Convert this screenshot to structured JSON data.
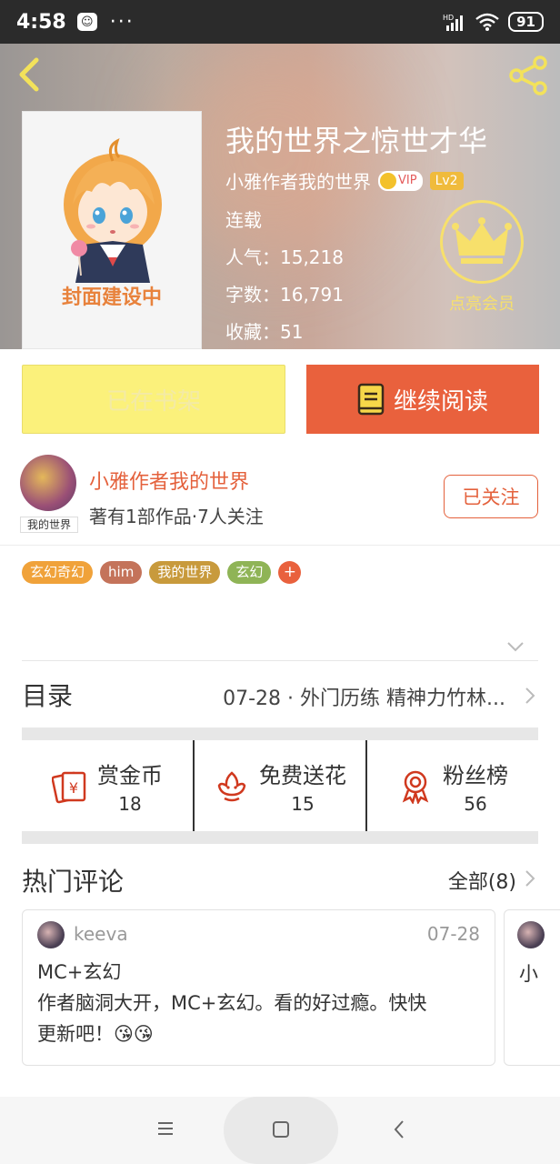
{
  "status_bar": {
    "time": "4:58",
    "dots": "···",
    "network": "HD",
    "battery": "91"
  },
  "book": {
    "title": "我的世界之惊世才华",
    "cover_text": "封面建设中",
    "author": "小雅作者我的世界",
    "vip_badge": "VIP",
    "level": "Lv2",
    "status": "连载",
    "popularity": "人气：15,218",
    "word_count": "字数：16,791",
    "favorites": "收藏：51",
    "vip_action": "点亮会员"
  },
  "actions": {
    "shelf_label": "已在书架",
    "read_label": "继续阅读"
  },
  "author_section": {
    "name": "小雅作者我的世界",
    "avatar_tag": "我的世界",
    "meta": "著有1部作品·7人关注",
    "follow_label": "已关注"
  },
  "tags": [
    {
      "label": "玄幻奇幻",
      "color": "#f0a23a"
    },
    {
      "label": "him",
      "color": "#c4735a"
    },
    {
      "label": "我的世界",
      "color": "#c89a3c"
    },
    {
      "label": "玄幻",
      "color": "#8fb456"
    },
    {
      "label": "+",
      "color": "#e9613d"
    }
  ],
  "toc": {
    "label": "目录",
    "latest_chapter": "07-28 · 外门历练 精神力竹林..."
  },
  "stats": [
    {
      "label": "赏金币",
      "value": "18",
      "icon": "reward-coin-icon"
    },
    {
      "label": "免费送花",
      "value": "15",
      "icon": "flower-icon"
    },
    {
      "label": "粉丝榜",
      "value": "56",
      "icon": "medal-icon"
    }
  ],
  "comments": {
    "title": "热门评论",
    "all_label": "全部(8)",
    "items": [
      {
        "user": "keeva",
        "date": "07-28",
        "line1": "MC+玄幻",
        "line2": "作者脑洞大开，MC+玄幻。看的好过瘾。快快",
        "line3": "更新吧！😘😘"
      }
    ],
    "peek_text": "小"
  },
  "colors": {
    "accent": "#e9613d",
    "shelf_yellow": "#fbf17b",
    "vip_gold": "#f7e06b"
  }
}
